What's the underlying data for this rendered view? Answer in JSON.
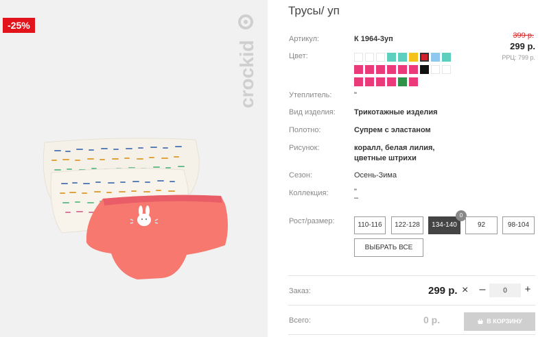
{
  "gallery": {
    "discount": "-25%",
    "brand": "crockid"
  },
  "product": {
    "title": "Трусы/ уп",
    "article_label": "Артикул:",
    "article": "К 1964-3уп",
    "price_old": "399 р.",
    "price": "299 р.",
    "price_rrp": "РРЦ: 799 р.",
    "color_label": "Цвет:",
    "swatch_colors": [
      "#ffffff",
      "#ffffff",
      "#ffffff",
      "#5ccfbf",
      "#5ccfbf",
      "#f4c21d",
      "#d0222d",
      "#8ec8ee",
      "#5ccfbf",
      "#ea3a7a",
      "#ea3a7a",
      "#ea3a7a",
      "#ea3a7a",
      "#ea3a7a",
      "#ea3a7a",
      "#111111",
      "#ffffff",
      "#ffffff",
      "#ea3a7a",
      "#ea3a7a",
      "#ea3a7a",
      "#ea3a7a",
      "#2e9248",
      "#ea3a7a"
    ],
    "selected_swatch": 6,
    "insulation_label": "Утеплитель:",
    "insulation": "\"",
    "type_label": "Вид изделия:",
    "type": "Трикотажные изделия",
    "fabric_label": "Полотно:",
    "fabric": "Супрем с эластаном",
    "pattern_label": "Рисунок:",
    "pattern_line1": "коралл, белая лилия,",
    "pattern_line2": "цветные штрихи",
    "season_label": "Сезон:",
    "season": "Осень-Зима",
    "collection_label": "Коллекция:",
    "collection_line1": "\"",
    "collection_line2": "–",
    "size_label": "Рост/размер:",
    "sizes": [
      "110-116",
      "122-128",
      "134-140",
      "92",
      "98-104"
    ],
    "selected_size": "134-140",
    "size_counter": "0",
    "select_all": "ВЫБРАТЬ ВСЕ"
  },
  "order": {
    "label": "Заказ:",
    "price": "299 р.",
    "times": "×",
    "minus": "–",
    "qty": "0",
    "plus": "+",
    "total_label": "Всего:",
    "total": "0 р.",
    "cart_button": "В КОРЗИНУ"
  }
}
